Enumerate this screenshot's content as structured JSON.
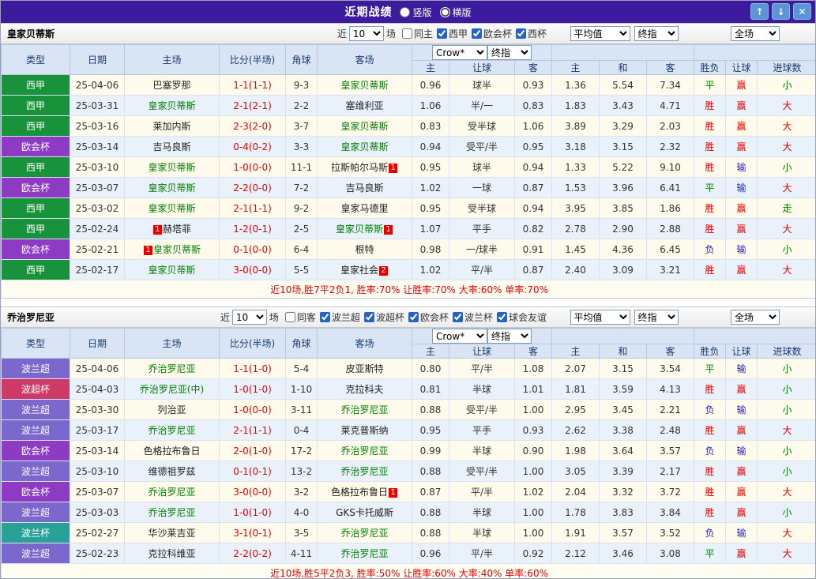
{
  "colors": {
    "vars": {
      "topbar": "#3c1b9e",
      "headbg": "#d9e5f4",
      "score": "#e60000",
      "focus": "#008000"
    },
    "result": {
      "win": "#e60000",
      "draw": "#008000",
      "lose": "#2222cc"
    },
    "leagues": {
      "西甲": "#18933c",
      "欧会杯": "#8d3bc2",
      "波兰超": "#7a68cc",
      "波超杯": "#cc3a66",
      "波兰杯": "#2aa198"
    }
  },
  "titlebar": {
    "title": "近期战绩",
    "layout_options": [
      {
        "label": "竖版",
        "selected": false
      },
      {
        "label": "横版",
        "selected": true
      }
    ],
    "buttons": [
      {
        "name": "up",
        "glyph": "↑"
      },
      {
        "name": "down",
        "glyph": "↓"
      },
      {
        "name": "close",
        "glyph": "✕"
      }
    ]
  },
  "sections": [
    {
      "team": "皇家贝蒂斯",
      "filters": {
        "near_label": "近",
        "count_value": "10",
        "games_label": "场",
        "same_venue": {
          "label": "同主",
          "checked": false
        },
        "competitions": [
          {
            "label": "西甲",
            "checked": true
          },
          {
            "label": "欧会杯",
            "checked": true
          },
          {
            "label": "西杯",
            "checked": true
          }
        ]
      },
      "selects": {
        "company": "Crow*",
        "company_kind": "终指",
        "average": "平均值",
        "average_kind": "终指",
        "scope": "全场"
      },
      "columns": [
        "类型",
        "日期",
        "主场",
        "比分(半场)",
        "角球",
        "客场",
        "主",
        "让球",
        "客",
        "主",
        "和",
        "客",
        "胜负",
        "让球",
        "进球数"
      ],
      "rows": [
        {
          "league": "西甲",
          "date": "25-04-06",
          "home": {
            "name": "巴塞罗那"
          },
          "score": "1-1(1-1)",
          "corner": "9-3",
          "away": {
            "name": "皇家贝蒂斯",
            "focus": true
          },
          "odds": [
            "0.96",
            "球半",
            "0.93",
            "1.36",
            "5.54",
            "7.34"
          ],
          "results": [
            [
              "平",
              "draw"
            ],
            [
              "赢",
              "win"
            ],
            [
              "小",
              "draw"
            ]
          ]
        },
        {
          "league": "西甲",
          "date": "25-03-31",
          "home": {
            "name": "皇家贝蒂斯",
            "focus": true
          },
          "score": "2-1(2-1)",
          "corner": "2-2",
          "away": {
            "name": "塞维利亚"
          },
          "odds": [
            "1.06",
            "半/一",
            "0.83",
            "1.83",
            "3.43",
            "4.71"
          ],
          "results": [
            [
              "胜",
              "win"
            ],
            [
              "赢",
              "win"
            ],
            [
              "大",
              "win"
            ]
          ]
        },
        {
          "league": "西甲",
          "date": "25-03-16",
          "home": {
            "name": "莱加内斯"
          },
          "score": "2-3(2-0)",
          "corner": "3-7",
          "away": {
            "name": "皇家贝蒂斯",
            "focus": true
          },
          "odds": [
            "0.83",
            "受半球",
            "1.06",
            "3.89",
            "3.29",
            "2.03"
          ],
          "results": [
            [
              "胜",
              "win"
            ],
            [
              "赢",
              "win"
            ],
            [
              "大",
              "win"
            ]
          ]
        },
        {
          "league": "欧会杯",
          "date": "25-03-14",
          "home": {
            "name": "吉马良斯"
          },
          "score": "0-4(0-2)",
          "corner": "3-3",
          "away": {
            "name": "皇家贝蒂斯",
            "focus": true
          },
          "odds": [
            "0.94",
            "受平/半",
            "0.95",
            "3.18",
            "3.15",
            "2.32"
          ],
          "results": [
            [
              "胜",
              "win"
            ],
            [
              "赢",
              "win"
            ],
            [
              "大",
              "win"
            ]
          ]
        },
        {
          "league": "西甲",
          "date": "25-03-10",
          "home": {
            "name": "皇家贝蒂斯",
            "focus": true
          },
          "score": "1-0(0-0)",
          "corner": "11-1",
          "away": {
            "name": "拉斯帕尔马斯",
            "badge": "1"
          },
          "odds": [
            "0.95",
            "球半",
            "0.94",
            "1.33",
            "5.22",
            "9.10"
          ],
          "results": [
            [
              "胜",
              "win"
            ],
            [
              "输",
              "lose"
            ],
            [
              "小",
              "draw"
            ]
          ]
        },
        {
          "league": "欧会杯",
          "date": "25-03-07",
          "home": {
            "name": "皇家贝蒂斯",
            "focus": true
          },
          "score": "2-2(0-0)",
          "corner": "7-2",
          "away": {
            "name": "吉马良斯"
          },
          "odds": [
            "1.02",
            "一球",
            "0.87",
            "1.53",
            "3.96",
            "6.41"
          ],
          "results": [
            [
              "平",
              "draw"
            ],
            [
              "输",
              "lose"
            ],
            [
              "大",
              "win"
            ]
          ]
        },
        {
          "league": "西甲",
          "date": "25-03-02",
          "home": {
            "name": "皇家贝蒂斯",
            "focus": true
          },
          "score": "2-1(1-1)",
          "corner": "9-2",
          "away": {
            "name": "皇家马德里"
          },
          "odds": [
            "0.95",
            "受半球",
            "0.94",
            "3.95",
            "3.85",
            "1.86"
          ],
          "results": [
            [
              "胜",
              "win"
            ],
            [
              "赢",
              "win"
            ],
            [
              "走",
              "draw"
            ]
          ]
        },
        {
          "league": "西甲",
          "date": "25-02-24",
          "home": {
            "name": "赫塔菲",
            "badge": "1",
            "badge_before": true
          },
          "score": "1-2(0-1)",
          "corner": "2-5",
          "away": {
            "name": "皇家贝蒂斯",
            "focus": true,
            "badge": "1"
          },
          "odds": [
            "1.07",
            "平手",
            "0.82",
            "2.78",
            "2.90",
            "2.88"
          ],
          "results": [
            [
              "胜",
              "win"
            ],
            [
              "赢",
              "win"
            ],
            [
              "大",
              "win"
            ]
          ]
        },
        {
          "league": "欧会杯",
          "date": "25-02-21",
          "home": {
            "name": "皇家贝蒂斯",
            "focus": true,
            "badge": "1",
            "badge_before": true
          },
          "score": "0-1(0-0)",
          "corner": "6-4",
          "away": {
            "name": "根特"
          },
          "odds": [
            "0.98",
            "一/球半",
            "0.91",
            "1.45",
            "4.36",
            "6.45"
          ],
          "results": [
            [
              "负",
              "lose"
            ],
            [
              "输",
              "lose"
            ],
            [
              "小",
              "draw"
            ]
          ]
        },
        {
          "league": "西甲",
          "date": "25-02-17",
          "home": {
            "name": "皇家贝蒂斯",
            "focus": true
          },
          "score": "3-0(0-0)",
          "corner": "5-5",
          "away": {
            "name": "皇家社会",
            "badge": "2"
          },
          "odds": [
            "1.02",
            "平/半",
            "0.87",
            "2.40",
            "3.09",
            "3.21"
          ],
          "results": [
            [
              "胜",
              "win"
            ],
            [
              "赢",
              "win"
            ],
            [
              "大",
              "win"
            ]
          ]
        }
      ],
      "summary": "近10场,胜7平2负1, 胜率:70% 让胜率:70% 大率:60% 单率:70%"
    },
    {
      "team": "乔治罗尼亚",
      "filters": {
        "near_label": "近",
        "count_value": "10",
        "games_label": "场",
        "same_venue": {
          "label": "同客",
          "checked": false
        },
        "competitions": [
          {
            "label": "波兰超",
            "checked": true
          },
          {
            "label": "波超杯",
            "checked": true
          },
          {
            "label": "欧会杯",
            "checked": true
          },
          {
            "label": "波兰杯",
            "checked": true
          },
          {
            "label": "球会友谊",
            "checked": true
          }
        ]
      },
      "selects": {
        "company": "Crow*",
        "company_kind": "终指",
        "average": "平均值",
        "average_kind": "终指",
        "scope": "全场"
      },
      "columns": [
        "类型",
        "日期",
        "主场",
        "比分(半场)",
        "角球",
        "客场",
        "主",
        "让球",
        "客",
        "主",
        "和",
        "客",
        "胜负",
        "让球",
        "进球数"
      ],
      "rows": [
        {
          "league": "波兰超",
          "date": "25-04-06",
          "home": {
            "name": "乔治罗尼亚",
            "focus": true
          },
          "score": "1-1(1-0)",
          "corner": "5-4",
          "away": {
            "name": "皮亚斯特"
          },
          "odds": [
            "0.80",
            "平/半",
            "1.08",
            "2.07",
            "3.15",
            "3.54"
          ],
          "results": [
            [
              "平",
              "draw"
            ],
            [
              "输",
              "lose"
            ],
            [
              "小",
              "draw"
            ]
          ]
        },
        {
          "league": "波超杯",
          "date": "25-04-03",
          "home": {
            "name": "乔治罗尼亚(中)",
            "focus": true
          },
          "score": "1-0(1-0)",
          "corner": "1-10",
          "away": {
            "name": "克拉科夫"
          },
          "odds": [
            "0.81",
            "半球",
            "1.01",
            "1.81",
            "3.59",
            "4.13"
          ],
          "results": [
            [
              "胜",
              "win"
            ],
            [
              "赢",
              "win"
            ],
            [
              "小",
              "draw"
            ]
          ]
        },
        {
          "league": "波兰超",
          "date": "25-03-30",
          "home": {
            "name": "列治亚"
          },
          "score": "1-0(0-0)",
          "corner": "3-11",
          "away": {
            "name": "乔治罗尼亚",
            "focus": true
          },
          "odds": [
            "0.88",
            "受平/半",
            "1.00",
            "2.95",
            "3.45",
            "2.21"
          ],
          "results": [
            [
              "负",
              "lose"
            ],
            [
              "输",
              "lose"
            ],
            [
              "小",
              "draw"
            ]
          ]
        },
        {
          "league": "波兰超",
          "date": "25-03-17",
          "home": {
            "name": "乔治罗尼亚",
            "focus": true
          },
          "score": "2-1(1-1)",
          "corner": "0-4",
          "away": {
            "name": "莱克普斯纳"
          },
          "odds": [
            "0.95",
            "平手",
            "0.93",
            "2.62",
            "3.38",
            "2.48"
          ],
          "results": [
            [
              "胜",
              "win"
            ],
            [
              "赢",
              "win"
            ],
            [
              "大",
              "win"
            ]
          ]
        },
        {
          "league": "欧会杯",
          "date": "25-03-14",
          "home": {
            "name": "色格拉布鲁日"
          },
          "score": "2-0(1-0)",
          "corner": "17-2",
          "away": {
            "name": "乔治罗尼亚",
            "focus": true
          },
          "odds": [
            "0.99",
            "半球",
            "0.90",
            "1.98",
            "3.64",
            "3.57"
          ],
          "results": [
            [
              "负",
              "lose"
            ],
            [
              "输",
              "lose"
            ],
            [
              "小",
              "draw"
            ]
          ]
        },
        {
          "league": "波兰超",
          "date": "25-03-10",
          "home": {
            "name": "维德祖罗兹"
          },
          "score": "0-1(0-1)",
          "corner": "13-2",
          "away": {
            "name": "乔治罗尼亚",
            "focus": true
          },
          "odds": [
            "0.88",
            "受平/半",
            "1.00",
            "3.05",
            "3.39",
            "2.17"
          ],
          "results": [
            [
              "胜",
              "win"
            ],
            [
              "赢",
              "win"
            ],
            [
              "小",
              "draw"
            ]
          ]
        },
        {
          "league": "欧会杯",
          "date": "25-03-07",
          "home": {
            "name": "乔治罗尼亚",
            "focus": true
          },
          "score": "3-0(0-0)",
          "corner": "3-2",
          "away": {
            "name": "色格拉布鲁日",
            "badge": "1"
          },
          "odds": [
            "0.87",
            "平/半",
            "1.02",
            "2.04",
            "3.32",
            "3.72"
          ],
          "results": [
            [
              "胜",
              "win"
            ],
            [
              "赢",
              "win"
            ],
            [
              "大",
              "win"
            ]
          ]
        },
        {
          "league": "波兰超",
          "date": "25-03-03",
          "home": {
            "name": "乔治罗尼亚",
            "focus": true
          },
          "score": "1-0(1-0)",
          "corner": "4-0",
          "away": {
            "name": "GKS卡托威斯"
          },
          "odds": [
            "0.88",
            "半球",
            "1.00",
            "1.78",
            "3.83",
            "3.84"
          ],
          "results": [
            [
              "胜",
              "win"
            ],
            [
              "赢",
              "win"
            ],
            [
              "小",
              "draw"
            ]
          ]
        },
        {
          "league": "波兰杯",
          "date": "25-02-27",
          "home": {
            "name": "华沙莱吉亚"
          },
          "score": "3-1(0-1)",
          "corner": "3-5",
          "away": {
            "name": "乔治罗尼亚",
            "focus": true
          },
          "odds": [
            "0.88",
            "半球",
            "1.00",
            "1.91",
            "3.57",
            "3.52"
          ],
          "results": [
            [
              "负",
              "lose"
            ],
            [
              "输",
              "lose"
            ],
            [
              "大",
              "win"
            ]
          ]
        },
        {
          "league": "波兰超",
          "date": "25-02-23",
          "home": {
            "name": "克拉科维亚"
          },
          "score": "2-2(0-2)",
          "corner": "4-11",
          "away": {
            "name": "乔治罗尼亚",
            "focus": true
          },
          "odds": [
            "0.96",
            "平/半",
            "0.92",
            "2.12",
            "3.46",
            "3.08"
          ],
          "results": [
            [
              "平",
              "draw"
            ],
            [
              "赢",
              "win"
            ],
            [
              "大",
              "win"
            ]
          ]
        }
      ],
      "summary": "近10场,胜5平2负3, 胜率:50% 让胜率:60% 大率:40% 单率:60%"
    }
  ]
}
